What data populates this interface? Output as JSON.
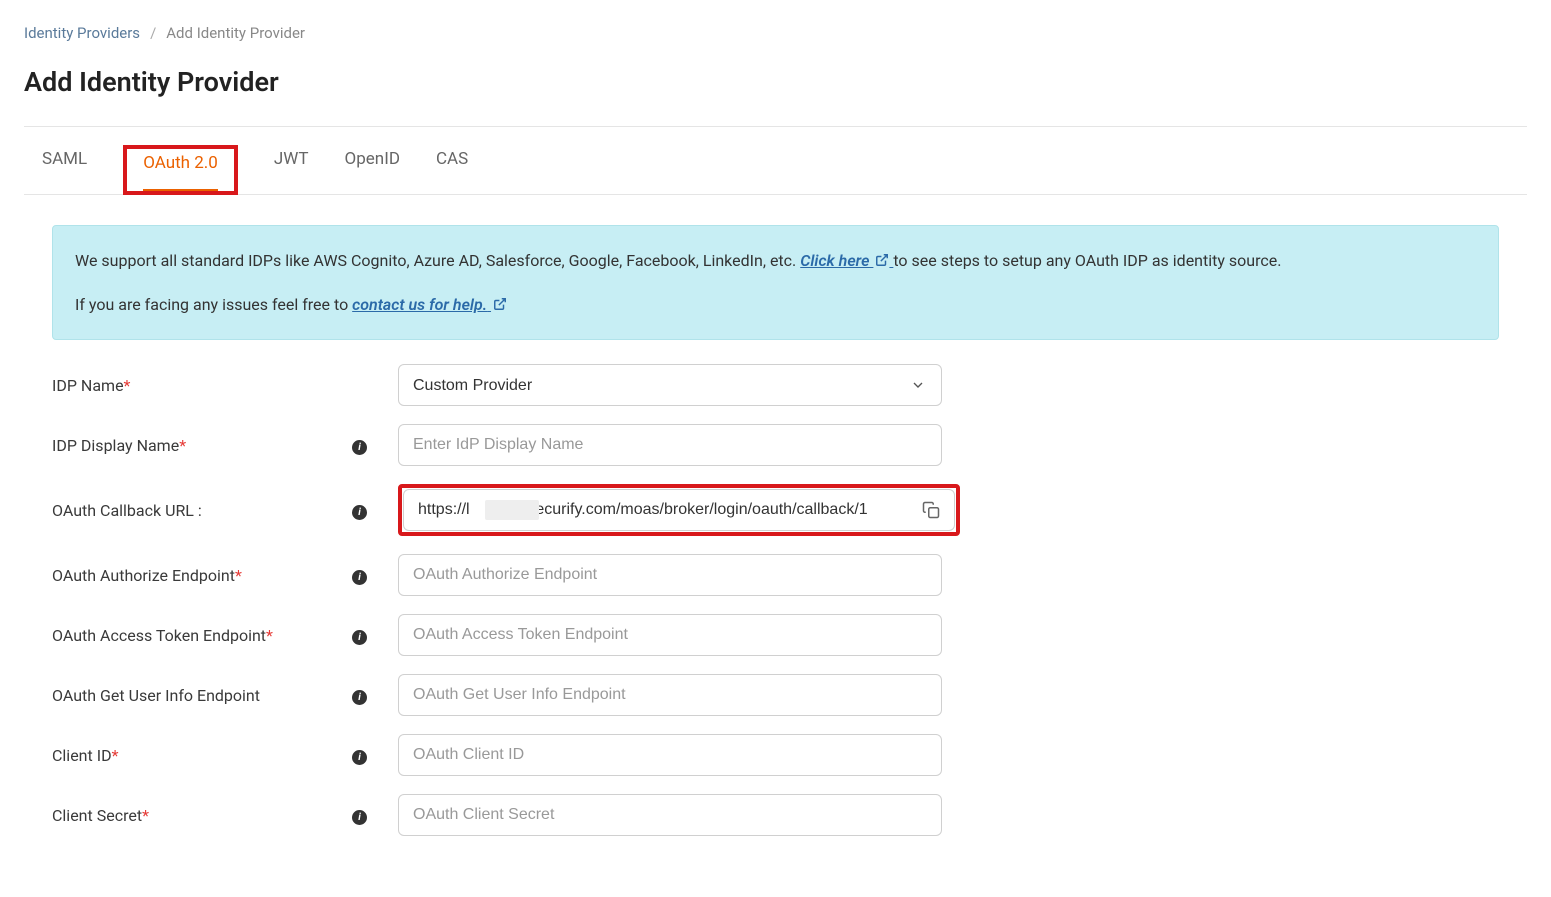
{
  "breadcrumb": {
    "parent": "Identity Providers",
    "current": "Add Identity Provider"
  },
  "page_title": "Add Identity Provider",
  "tabs": [
    {
      "label": "SAML",
      "active": false
    },
    {
      "label": "OAuth 2.0",
      "active": true
    },
    {
      "label": "JWT",
      "active": false
    },
    {
      "label": "OpenID",
      "active": false
    },
    {
      "label": "CAS",
      "active": false
    }
  ],
  "info": {
    "line1_prefix": "We support all standard IDPs like AWS Cognito, Azure AD, Salesforce, Google, Facebook, LinkedIn, etc. ",
    "line1_link": "Click here",
    "line1_suffix": " to see steps to setup any OAuth IDP as identity source.",
    "line2_prefix": "If you are facing any issues feel free to ",
    "line2_link": "contact us for help."
  },
  "form": {
    "idp_name": {
      "label": "IDP Name",
      "value": "Custom Provider"
    },
    "idp_display_name": {
      "label": "IDP Display Name",
      "placeholder": "Enter IdP Display Name"
    },
    "callback": {
      "label": "OAuth Callback URL :",
      "value": "https://l            .xecurify.com/moas/broker/login/oauth/callback/1"
    },
    "authorize": {
      "label": "OAuth Authorize Endpoint",
      "placeholder": "OAuth Authorize Endpoint"
    },
    "token": {
      "label": "OAuth Access Token Endpoint",
      "placeholder": "OAuth Access Token Endpoint"
    },
    "userinfo": {
      "label": "OAuth Get User Info Endpoint",
      "placeholder": "OAuth Get User Info Endpoint"
    },
    "client_id": {
      "label": "Client ID",
      "placeholder": "OAuth Client ID"
    },
    "client_secret": {
      "label": "Client Secret",
      "placeholder": "OAuth Client Secret"
    }
  }
}
